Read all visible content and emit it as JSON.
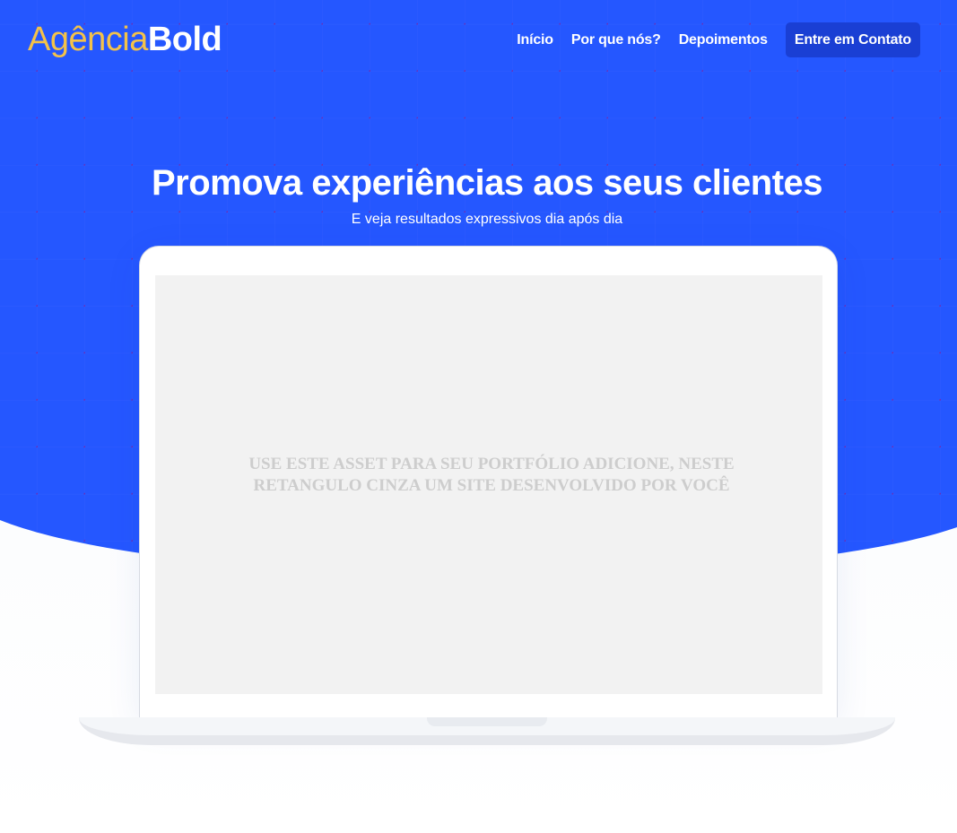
{
  "brand": {
    "logo_light": "Agência",
    "logo_bold": "Bold",
    "accent_color": "#f3c24a",
    "primary_color": "#2557ff",
    "button_color": "#1a3fd4"
  },
  "nav": {
    "items": [
      {
        "label": "Início"
      },
      {
        "label": "Por que nós?"
      },
      {
        "label": "Depoimentos"
      }
    ],
    "cta_label": "Entre em Contato"
  },
  "hero": {
    "title": "Promova experiências aos seus clientes",
    "subtitle": "E veja resultados expressivos dia após dia"
  },
  "laptop": {
    "placeholder_text": "USE ESTE ASSET PARA SEU PORTFÓLIO ADICIONE, NESTE RETANGULO CINZA UM SITE DESENVOLVIDO POR VOCÊ"
  }
}
